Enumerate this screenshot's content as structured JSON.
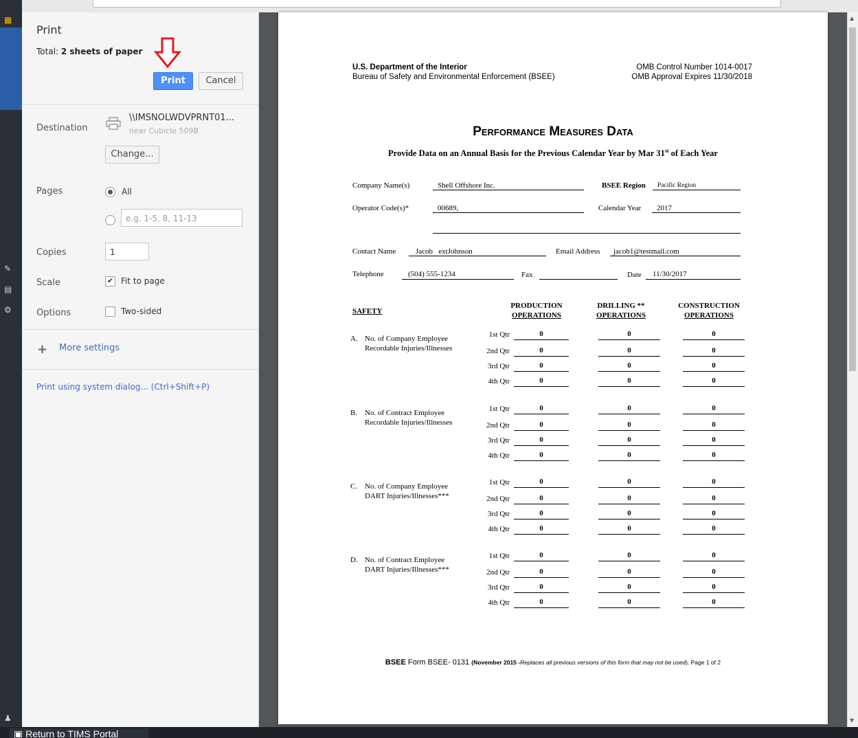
{
  "app": {
    "return_link": "Return to TIMS Portal"
  },
  "dialog": {
    "title": "Print",
    "total_prefix": "Total: ",
    "total_value": "2 sheets of paper",
    "print_button": "Print",
    "cancel_button": "Cancel",
    "destination_label": "Destination",
    "destination_name": "\\\\IMSNOLWDVPRNT01...",
    "destination_sub": "near Cubicle 509B",
    "change_button": "Change...",
    "pages_label": "Pages",
    "pages_all": "All",
    "pages_placeholder": "e.g. 1-5, 8, 11-13",
    "copies_label": "Copies",
    "copies_value": "1",
    "scale_label": "Scale",
    "fit_to_page": "Fit to page",
    "options_label": "Options",
    "two_sided": "Two-sided",
    "more_settings": "More settings",
    "system_dialog": "Print using system dialog... (Ctrl+Shift+P)"
  },
  "form": {
    "agency_line1": "U.S. Department of the Interior",
    "agency_line2": "Bureau of Safety and Environmental Enforcement (BSEE)",
    "omb_line1": "OMB Control Number 1014-0017",
    "omb_line2": "OMB Approval Expires 11/30/2018",
    "title": "Performance Measures Data",
    "subtitle_pre": "Provide Data on an Annual Basis for the Previous Calendar Year by Mar 31",
    "subtitle_sup": "st",
    "subtitle_post": " of Each Year",
    "company_label": "Company Name(s)",
    "company_value": "Shell Offshore Inc.",
    "region_label": "BSEE Region",
    "region_value": "Pacific Region",
    "operator_label": "Operator Code(s)*",
    "operator_value": "00689,",
    "year_label": "Calendar Year",
    "year_value": "2017",
    "contact_label": "Contact Name",
    "contact_value": "Jacob   extJohnson",
    "email_label": "Email Address",
    "email_value": "jacob1@testmail.com",
    "phone_label": "Telephone",
    "phone_value": "(504) 555-1234",
    "fax_label": "Fax",
    "date_label": "Date",
    "date_value": "11/30/2017",
    "safety_label": "SAFETY",
    "col1_line1": "PRODUCTION",
    "col1_line2": "OPERATIONS",
    "col2_line1": "DRILLING **",
    "col2_line2": "OPERATIONS",
    "col3_line1": "CONSTRUCTION",
    "col3_line2": "OPERATIONS",
    "quarters": [
      "1st Qtr",
      "2nd Qtr",
      "3rd Qtr",
      "4th Qtr"
    ],
    "sections": [
      {
        "letter": "A.",
        "line1": "No. of Company Employee",
        "line2": "Recordable Injuries/Illnesses",
        "values": [
          [
            "0",
            "0",
            "0"
          ],
          [
            "0",
            "0",
            "0"
          ],
          [
            "0",
            "0",
            "0"
          ],
          [
            "0",
            "0",
            "0"
          ]
        ]
      },
      {
        "letter": "B.",
        "line1": "No. of Contract Employee",
        "line2": "Recordable Injuries/Illnesses",
        "values": [
          [
            "0",
            "0",
            "0"
          ],
          [
            "0",
            "0",
            "0"
          ],
          [
            "0",
            "0",
            "0"
          ],
          [
            "0",
            "0",
            "0"
          ]
        ]
      },
      {
        "letter": "C.",
        "line1": "No. of Company Employee",
        "line2": "DART Injuries/Illnesses***",
        "values": [
          [
            "0",
            "0",
            "0"
          ],
          [
            "0",
            "0",
            "0"
          ],
          [
            "0",
            "0",
            "0"
          ],
          [
            "0",
            "0",
            "0"
          ]
        ]
      },
      {
        "letter": "D.",
        "line1": "No. of Contract Employee",
        "line2": "DART Injuries/Illnesses***",
        "values": [
          [
            "0",
            "0",
            "0"
          ],
          [
            "0",
            "0",
            "0"
          ],
          [
            "0",
            "0",
            "0"
          ],
          [
            "0",
            "0",
            "0"
          ]
        ]
      }
    ],
    "footer_bold": "BSEE",
    "footer_form": " Form BSEE- 0131 ",
    "footer_small_bold": "(November 2015 -",
    "footer_italic": "Replaces all previous versions of this form that may not be used",
    "footer_end": "). Page 1 of 2"
  }
}
